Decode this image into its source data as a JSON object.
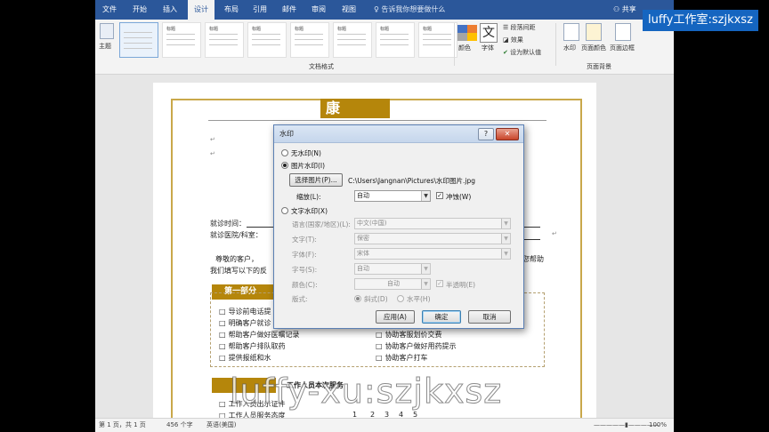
{
  "tabs": [
    "文件",
    "开始",
    "插入",
    "设计",
    "布局",
    "引用",
    "邮件",
    "审阅",
    "视图"
  ],
  "active_tab": "设计",
  "tell_me": "告诉我你想要做什么",
  "share": "共享",
  "ribbon": {
    "theme_label": "主题",
    "gallery_title": "标题",
    "group_doc_format": "文档格式",
    "colors_label": "颜色",
    "fonts_label": "字体",
    "paragraph_spacing": "段落间距",
    "effects": "效果",
    "set_default": "设为默认值",
    "watermark": "水印",
    "page_color": "页面颜色",
    "page_border": "页面边框",
    "group_page_bg": "页面背景"
  },
  "document": {
    "header_char": "康",
    "visit_time": "就诊时间：",
    "hospital": "就诊医院/科室：",
    "greeting": "尊敬的客户，",
    "line2": "我们填写以下的反",
    "right_frag": "您帮助",
    "section1": "第一部分",
    "items_left": [
      "导诊前电话提",
      "明确客户就诊",
      "帮助客户做好医嘱记录",
      "帮助客户排队取药",
      "提供报纸和水"
    ],
    "items_right": [
      "协助客户打车"
    ],
    "items_right_mid": [
      "协助客户做好用药提示"
    ],
    "items_right_top": [
      "协助客服划价交费"
    ],
    "section2_tail": "工作人员本次服务",
    "items2": [
      "工作人员出示证件",
      "工作人员服务态度"
    ],
    "scale": [
      "1",
      "2",
      "3",
      "4",
      "5"
    ]
  },
  "dialog": {
    "title": "水印",
    "help": "?",
    "close": "✕",
    "no_wm": "无水印(N)",
    "pic_wm": "图片水印(I)",
    "select_pic": "选择图片(P)...",
    "pic_path": "C:\\Users\\Jangnan\\Pictures\\水印图片.jpg",
    "scale_label": "缩放(L):",
    "scale_value": "自动",
    "washout": "冲蚀(W)",
    "text_wm": "文字水印(X)",
    "lang_label": "语言(国家/地区)(L):",
    "lang_value": "中文(中国)",
    "text_label": "文字(T):",
    "text_value": "保密",
    "font_label": "字体(F):",
    "font_value": "宋体",
    "size_label": "字号(S):",
    "size_value": "自动",
    "color_label": "颜色(C):",
    "color_value": "自动",
    "semi": "半透明(E)",
    "layout_label": "版式:",
    "diag": "斜式(D)",
    "horiz": "水平(H)",
    "apply": "应用(A)",
    "ok": "确定",
    "cancel": "取消"
  },
  "status": {
    "page": "第 1 页，共 1 页",
    "words": "456 个字",
    "lang": "英语(美国)",
    "zoom": "100%"
  },
  "overlay": {
    "badge": "luffy工作室:szjkxsz",
    "watermark": "luffy-xu:szjkxsz"
  },
  "colors": {
    "word_blue": "#2b579a",
    "gold": "#b5860b",
    "badge": "#1565c0"
  }
}
